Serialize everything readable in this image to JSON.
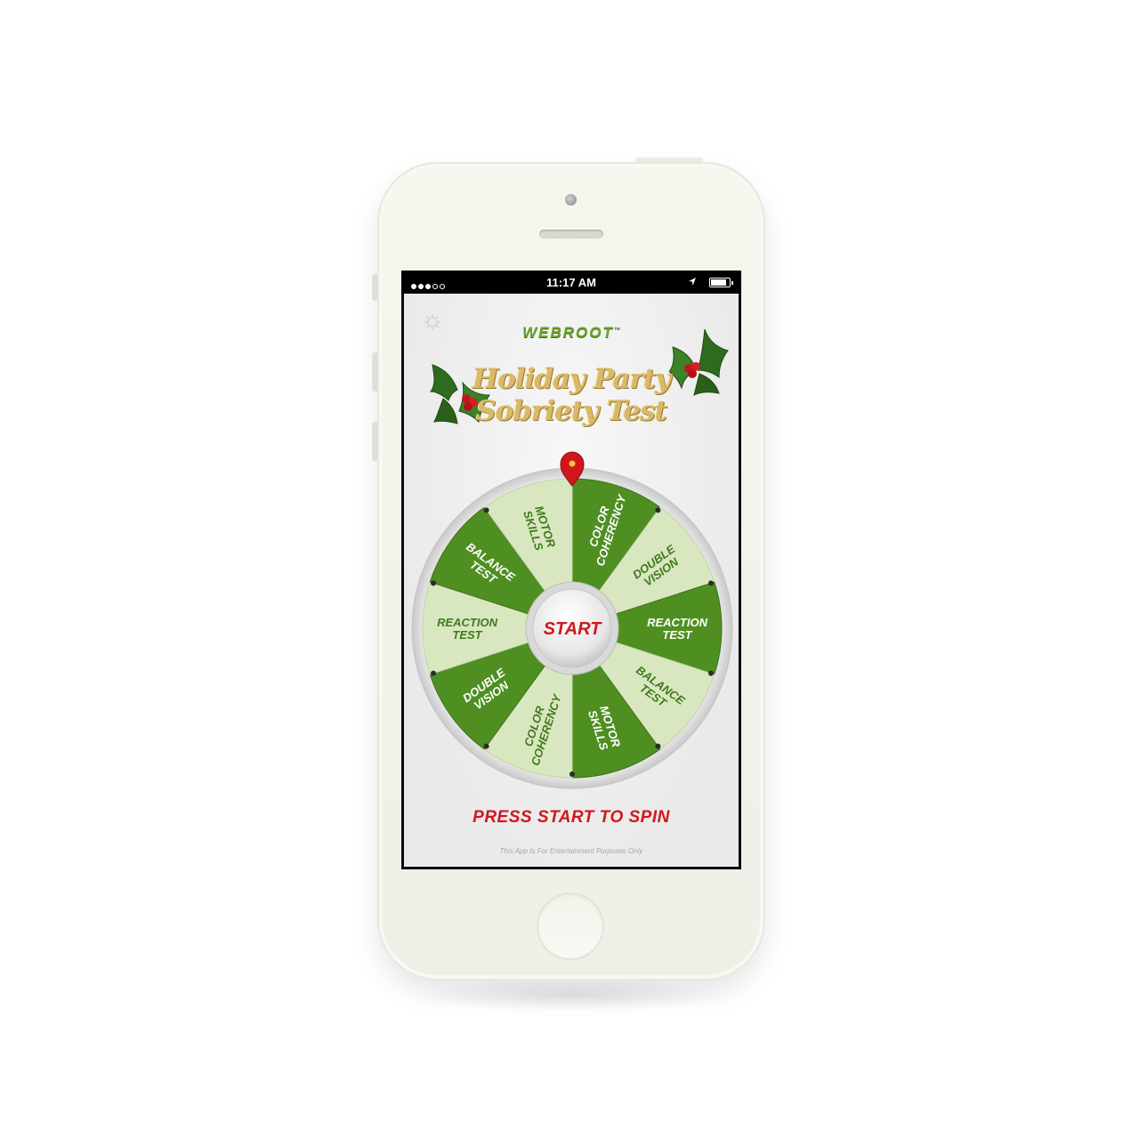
{
  "status_bar": {
    "time": "11:17 AM",
    "signal_full": 3,
    "signal_total": 5,
    "battery_level": 0.85
  },
  "app": {
    "brand": "WEBROOT",
    "brand_mark": "™",
    "title_line1": "Holiday Party",
    "title_line2": "Sobriety Test",
    "start_label": "START",
    "press_start": "PRESS START TO SPIN",
    "disclaimer": "This App Is For Entertainment Purposes Only",
    "wheel_segments": [
      {
        "label": [
          "COLOR",
          "COHERENCY"
        ],
        "shade": "dark"
      },
      {
        "label": [
          "DOUBLE",
          "VISION"
        ],
        "shade": "light"
      },
      {
        "label": [
          "REACTION",
          "TEST"
        ],
        "shade": "dark"
      },
      {
        "label": [
          "BALANCE",
          "TEST"
        ],
        "shade": "light"
      },
      {
        "label": [
          "MOTOR",
          "SKILLS"
        ],
        "shade": "dark"
      },
      {
        "label": [
          "COLOR",
          "COHERENCY"
        ],
        "shade": "light"
      },
      {
        "label": [
          "DOUBLE",
          "VISION"
        ],
        "shade": "dark"
      },
      {
        "label": [
          "REACTION",
          "TEST"
        ],
        "shade": "light"
      },
      {
        "label": [
          "BALANCE",
          "TEST"
        ],
        "shade": "dark"
      },
      {
        "label": [
          "MOTOR",
          "SKILLS"
        ],
        "shade": "light"
      }
    ]
  },
  "colors": {
    "wheel_dark": "#4f8f22",
    "wheel_light": "#d9e7c1",
    "label_on_dark": "#ffffff",
    "label_on_light": "#3f7a1c",
    "accent_red": "#d2161e",
    "gold": "#d9b869",
    "brand_green": "#6aa22c"
  },
  "icons": {
    "settings": "gear-icon",
    "location": "location-arrow-icon",
    "battery": "battery-icon",
    "pointer": "map-pin-pointer-icon",
    "holly": "holly-leaves-icon"
  }
}
